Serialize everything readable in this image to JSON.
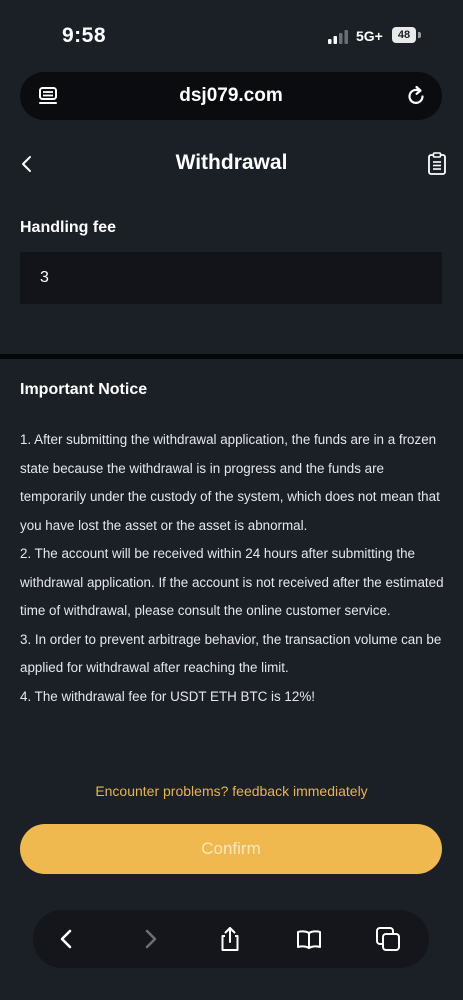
{
  "status_bar": {
    "time": "9:58",
    "network": "5G+",
    "battery": "48"
  },
  "browser": {
    "url": "dsj079.com",
    "left_icon": "tab-overview-icon",
    "reload_icon": "reload-icon"
  },
  "header": {
    "title": "Withdrawal",
    "back_icon": "chevron-left-icon",
    "record_icon": "clipboard-icon"
  },
  "fee": {
    "label": "Handling fee",
    "value": "3"
  },
  "notice": {
    "title": "Important Notice",
    "items": [
      "1. After submitting the withdrawal application, the funds are in a frozen state because the withdrawal is in progress and the funds are temporarily under the custody of the system, which does not mean that you have lost the asset or the asset is abnormal.",
      "2. The account will be received within 24 hours after submitting the withdrawal application. If the account is not received after the estimated time of withdrawal, please consult the online customer service.",
      "3. In order to prevent arbitrage behavior, the transaction volume can be applied for withdrawal after reaching the limit.",
      "4. The withdrawal fee for USDT ETH BTC is 12%!"
    ]
  },
  "feedback_link": "Encounter problems? feedback immediately",
  "confirm_label": "Confirm",
  "toolbar": {
    "icons": [
      "back-icon",
      "forward-icon",
      "share-icon",
      "bookmarks-icon",
      "tabs-icon"
    ]
  },
  "colors": {
    "background": "#1b1f26",
    "accent": "#f0b94f",
    "link": "#e8b44f",
    "input_bg": "#12141a"
  }
}
